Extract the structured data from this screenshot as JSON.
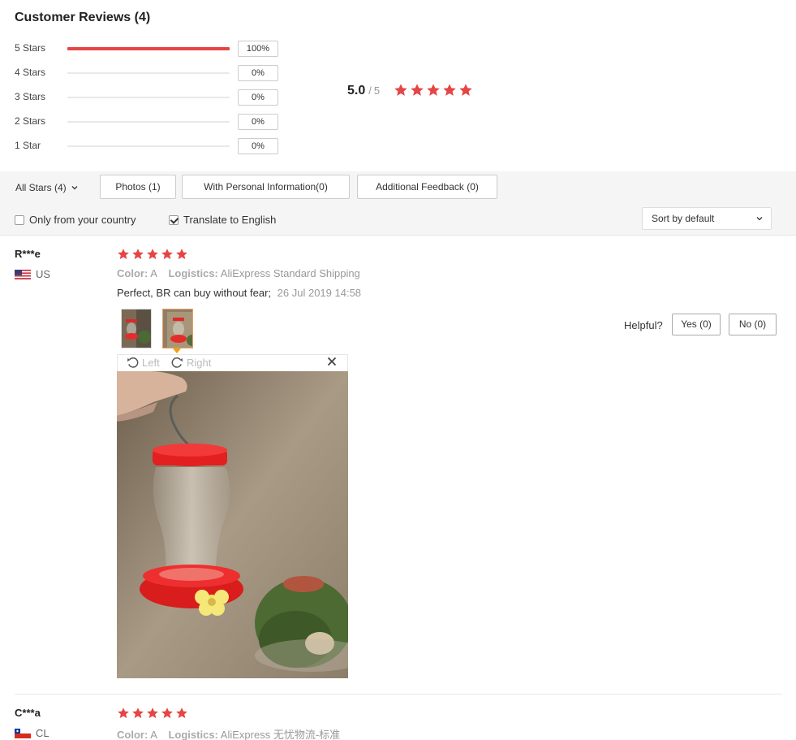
{
  "title": "Customer Reviews (4)",
  "distribution": [
    {
      "label": "5 Stars",
      "percent": 100,
      "percent_text": "100%"
    },
    {
      "label": "4 Stars",
      "percent": 0,
      "percent_text": "0%"
    },
    {
      "label": "3 Stars",
      "percent": 0,
      "percent_text": "0%"
    },
    {
      "label": "2 Stars",
      "percent": 0,
      "percent_text": "0%"
    },
    {
      "label": "1 Star",
      "percent": 0,
      "percent_text": "0%"
    }
  ],
  "average": {
    "score": "5.0",
    "separator": "/",
    "max": "5",
    "stars": 5
  },
  "filters": {
    "all_stars": "All Stars (4)",
    "buttons": [
      "Photos (1)",
      "With Personal Information(0)",
      "Additional Feedback (0)"
    ],
    "only_country": "Only from your country",
    "translate": "Translate to English",
    "sort": "Sort by default"
  },
  "reviews": [
    {
      "name": "R***e",
      "country": "US",
      "stars": 5,
      "color_label": "Color:",
      "color_value": "A",
      "logistics_label": "Logistics:",
      "logistics_value": "AliExpress Standard Shipping",
      "text": "Perfect, BR can buy without fear;",
      "date": "26 Jul 2019 14:58",
      "helpful_label": "Helpful?",
      "yes": "Yes (0)",
      "no": "No (0)",
      "viewer": {
        "left": "Left",
        "right": "Right"
      }
    },
    {
      "name": "C***a",
      "country": "CL",
      "stars": 5,
      "color_label": "Color:",
      "color_value": "A",
      "logistics_label": "Logistics:",
      "logistics_value": "AliExpress 无忧物流-标准"
    }
  ],
  "colors": {
    "accent": "#e64545",
    "star": "#e64545"
  }
}
